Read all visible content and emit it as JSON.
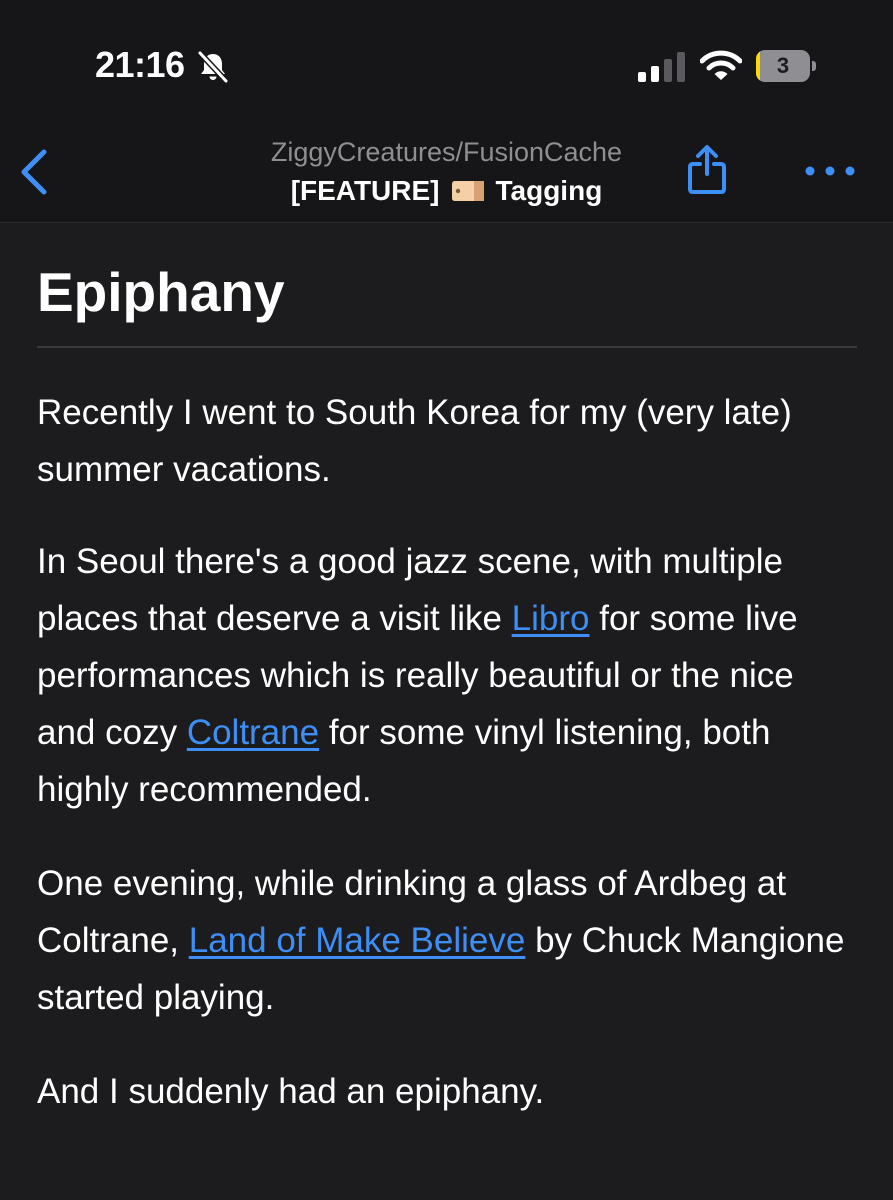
{
  "status_bar": {
    "time": "21:16",
    "battery_level": "3",
    "battery_fraction": 0.08,
    "icons": [
      "bell-slash-icon",
      "cellular-signal-icon",
      "wifi-icon",
      "battery-icon"
    ]
  },
  "nav": {
    "back_icon": "chevron-left-icon",
    "subtitle": "ZiggyCreatures/FusionCache",
    "title_prefix": "[FEATURE]",
    "title_icon": "label-tag-icon",
    "title_suffix": "Tagging",
    "share_icon": "share-icon",
    "more_icon": "ellipsis-icon"
  },
  "article": {
    "heading": "Epiphany",
    "p1": "Recently I went to South Korea for my (very late) summer vacations.",
    "p2": {
      "t1": "In Seoul there's a good jazz scene, with multiple places that deserve a visit like ",
      "link1": "Libro",
      "t2": " for some live performances which is really beautiful or the nice and cozy ",
      "link2": "Coltrane",
      "t3": " for some vinyl listening, both highly recommended."
    },
    "p3": {
      "t1": "One evening, while drinking a glass of Ardbeg at Coltrane, ",
      "link": "Land of Make Believe",
      "t2": " by Chuck Mangione started playing."
    },
    "p4": "And I suddenly had an epiphany."
  },
  "colors": {
    "background": "#1c1c1e",
    "accent": "#3d8ff5",
    "secondary_text": "#8e8e93",
    "battery_low": "#ffd60a"
  }
}
